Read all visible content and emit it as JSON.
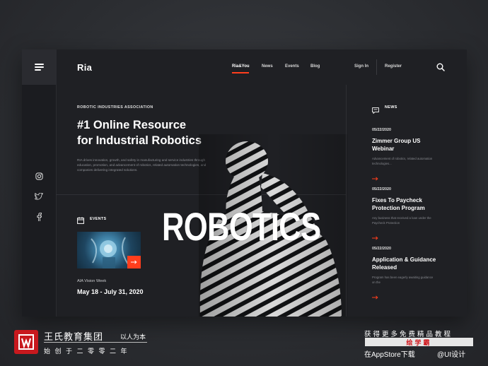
{
  "header": {
    "logo": "Ria",
    "nav": [
      "Ria&You",
      "News",
      "Events",
      "Blog"
    ],
    "sign_in": "Sign In",
    "register": "Register"
  },
  "hero": {
    "association": "ROBOTIC INDUSTRIES ASSOCIATION",
    "headline_line1": "#1 Online Resource",
    "headline_line2": "for Industrial Robotics",
    "description": "RIA drives innovation, growth, and safety in manufacturing and service industries through education, promotion, and advancement of robotics, related automation technologies, and companies delivering integrated solutions.",
    "big_word": "ROBOTICS"
  },
  "events": {
    "label": "EVENTS",
    "title": "AIA Vision Week",
    "date": "May 18 - July 31, 2020"
  },
  "news": {
    "label": "NEWS",
    "items": [
      {
        "date": "05/22/2020",
        "title": "Zimmer Group US Webinar",
        "text": "Advancement of robotics, related automation technologies..."
      },
      {
        "date": "05/22/2020",
        "title": "Fixes To Paycheck Protection Program",
        "text": "Any business that received a loan under the Paycheck Protection"
      },
      {
        "date": "05/22/2020",
        "title": "Application & Guidance Released",
        "text": "Program has been eagerly awaiting guidance on the"
      }
    ]
  },
  "watermark": {
    "org": "王氏教育集团",
    "motto": "以人为本",
    "sub": "始创于二零零二年",
    "promo": "获得更多免费精品教程",
    "badge": "绘学霸",
    "store": "在AppStore下载",
    "handle": "@UI设计"
  },
  "colors": {
    "accent": "#ff3e1d",
    "panel": "#1f2024",
    "background": "#2e3034"
  }
}
